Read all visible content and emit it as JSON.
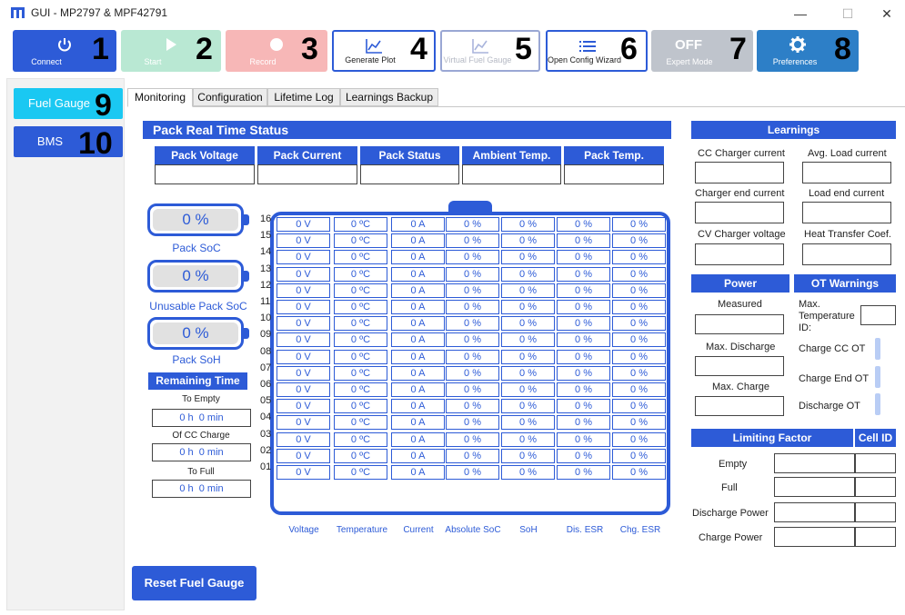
{
  "window": {
    "title": "GUI - MP2797 & MPF42791",
    "controls": {
      "minimize": "—",
      "maximize": "☐",
      "close": "✕"
    }
  },
  "toolbar": {
    "buttons": [
      {
        "label": "Connect",
        "icon": "power-icon",
        "number": "1",
        "bg": "#2d5bd7"
      },
      {
        "label": "Start",
        "icon": "play-icon",
        "number": "2",
        "bg": "#b9e8d3"
      },
      {
        "label": "Record",
        "icon": "record-icon",
        "number": "3",
        "bg": "#f7b7b7"
      },
      {
        "label": "Generate Plot",
        "icon": "chart-line-icon",
        "number": "4"
      },
      {
        "label": "Virtual Fuel Gauge",
        "icon": "chart-line-icon",
        "number": "5"
      },
      {
        "label": "Open Config Wizard",
        "icon": "list-icon",
        "number": "6"
      },
      {
        "label": "Expert Mode",
        "toggle_text": "OFF",
        "number": "7",
        "bg": "#bfc4cc"
      },
      {
        "label": "Preferences",
        "icon": "gear-icon",
        "number": "8",
        "bg": "#2d7fc7"
      }
    ]
  },
  "sidebar": {
    "items": [
      {
        "label": "Fuel Gauge",
        "number": "9",
        "bg": "#1ac8f2"
      },
      {
        "label": "BMS",
        "number": "10",
        "bg": "#2d5bd7"
      }
    ]
  },
  "tabs": [
    "Monitoring",
    "Configuration",
    "Lifetime Log",
    "Learnings Backup"
  ],
  "pack_status": {
    "title": "Pack Real Time Status",
    "columns": [
      "Pack Voltage",
      "Pack Current",
      "Pack Status",
      "Ambient Temp.",
      "Pack Temp."
    ]
  },
  "gauges": [
    {
      "value": "0 %",
      "label": "Pack SoC"
    },
    {
      "value": "0 %",
      "label": "Unusable Pack SoC"
    },
    {
      "value": "0 %",
      "label": "Pack SoH"
    }
  ],
  "remaining_time": {
    "title": "Remaining Time",
    "rows": [
      {
        "label": "To Empty",
        "hours": "0 h",
        "minutes": "0 min"
      },
      {
        "label": "Of CC Charge",
        "hours": "0 h",
        "minutes": "0 min"
      },
      {
        "label": "To Full",
        "hours": "0 h",
        "minutes": "0 min"
      }
    ]
  },
  "cells": {
    "row_labels": [
      "16",
      "15",
      "14",
      "13",
      "12",
      "11",
      "10",
      "09",
      "08",
      "07",
      "06",
      "05",
      "04",
      "03",
      "02",
      "01"
    ],
    "values": [
      "0 V",
      "0 ºC",
      "0 A",
      "0 %",
      "0 %",
      "0 %",
      "0 %"
    ],
    "columns": [
      "Voltage",
      "Temperature",
      "Current",
      "Absolute SoC",
      "SoH",
      "Dis. ESR",
      "Chg. ESR"
    ]
  },
  "reset_button": "Reset Fuel Gauge",
  "learnings": {
    "title": "Learnings",
    "fields": [
      "CC Charger current",
      "Avg. Load current",
      "Charger end current",
      "Load end current",
      "CV Charger voltage",
      "Heat Transfer Coef."
    ]
  },
  "power": {
    "title": "Power",
    "fields": [
      "Measured",
      "Max. Discharge",
      "Max. Charge"
    ]
  },
  "ot_warnings": {
    "title": "OT Warnings",
    "max_temp_label": "Max. Temperature ID:",
    "items": [
      "Charge CC OT",
      "Charge End OT",
      "Discharge OT"
    ]
  },
  "limiting": {
    "title": "Limiting Factor",
    "cell_id": "Cell ID",
    "rows": [
      "Empty",
      "Full",
      "Discharge Power",
      "Charge Power"
    ]
  },
  "colors": {
    "accent": "#2d5bd7",
    "sidebar_active": "#1ac8f2"
  }
}
